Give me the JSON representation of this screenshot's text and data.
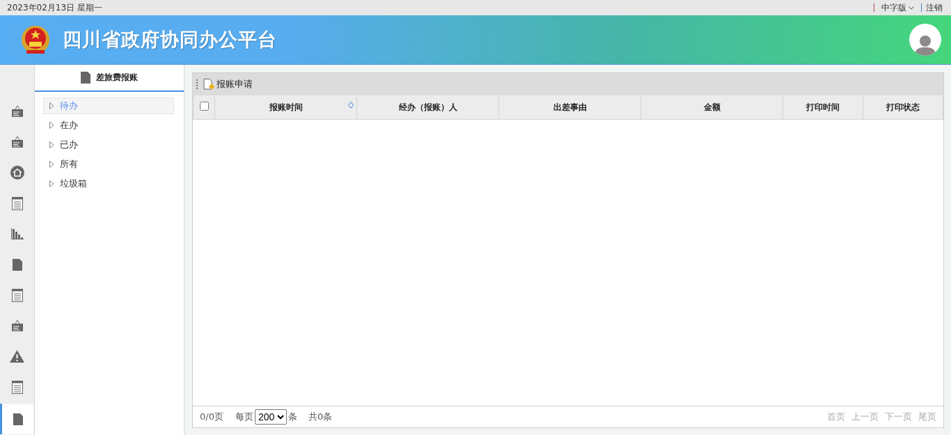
{
  "top_bar": {
    "date": "2023年02月13日 星期一",
    "language": "中字版",
    "logout": "注销"
  },
  "header": {
    "title": "四川省政府协同办公平台"
  },
  "rail": [
    {
      "kind": "sign",
      "selected": false
    },
    {
      "kind": "sign",
      "selected": false
    },
    {
      "kind": "home",
      "selected": false
    },
    {
      "kind": "notepad",
      "selected": false
    },
    {
      "kind": "chart",
      "selected": false
    },
    {
      "kind": "file",
      "selected": false
    },
    {
      "kind": "notepad",
      "selected": false
    },
    {
      "kind": "sign",
      "selected": false
    },
    {
      "kind": "warning",
      "selected": false
    },
    {
      "kind": "notepad",
      "selected": false
    },
    {
      "kind": "file",
      "selected": true
    }
  ],
  "tree": {
    "title": "差旅费报账",
    "items": [
      {
        "label": "待办",
        "selected": true
      },
      {
        "label": "在办",
        "selected": false
      },
      {
        "label": "已办",
        "selected": false
      },
      {
        "label": "所有",
        "selected": false
      },
      {
        "label": "垃圾箱",
        "selected": false
      }
    ]
  },
  "toolbar": {
    "buttons": [
      "报账申请"
    ]
  },
  "table": {
    "select_all": false,
    "columns": [
      {
        "label": "报账时间",
        "sortable": true
      },
      {
        "label": "经办（报账）人",
        "sortable": false
      },
      {
        "label": "出差事由",
        "sortable": false
      },
      {
        "label": "金额",
        "sortable": false
      },
      {
        "label": "打印时间",
        "sortable": false
      },
      {
        "label": "打印状态",
        "sortable": false
      }
    ]
  },
  "pager": {
    "page_info": "0/0页",
    "per_page_label": "每页",
    "per_page": "200",
    "per_page_unit": "条",
    "total": "共0条",
    "links": [
      {
        "label": "首页",
        "disabled": true
      },
      {
        "label": "上一页",
        "disabled": true
      },
      {
        "label": "下一页",
        "disabled": true
      },
      {
        "label": "尾页",
        "disabled": true
      }
    ]
  }
}
